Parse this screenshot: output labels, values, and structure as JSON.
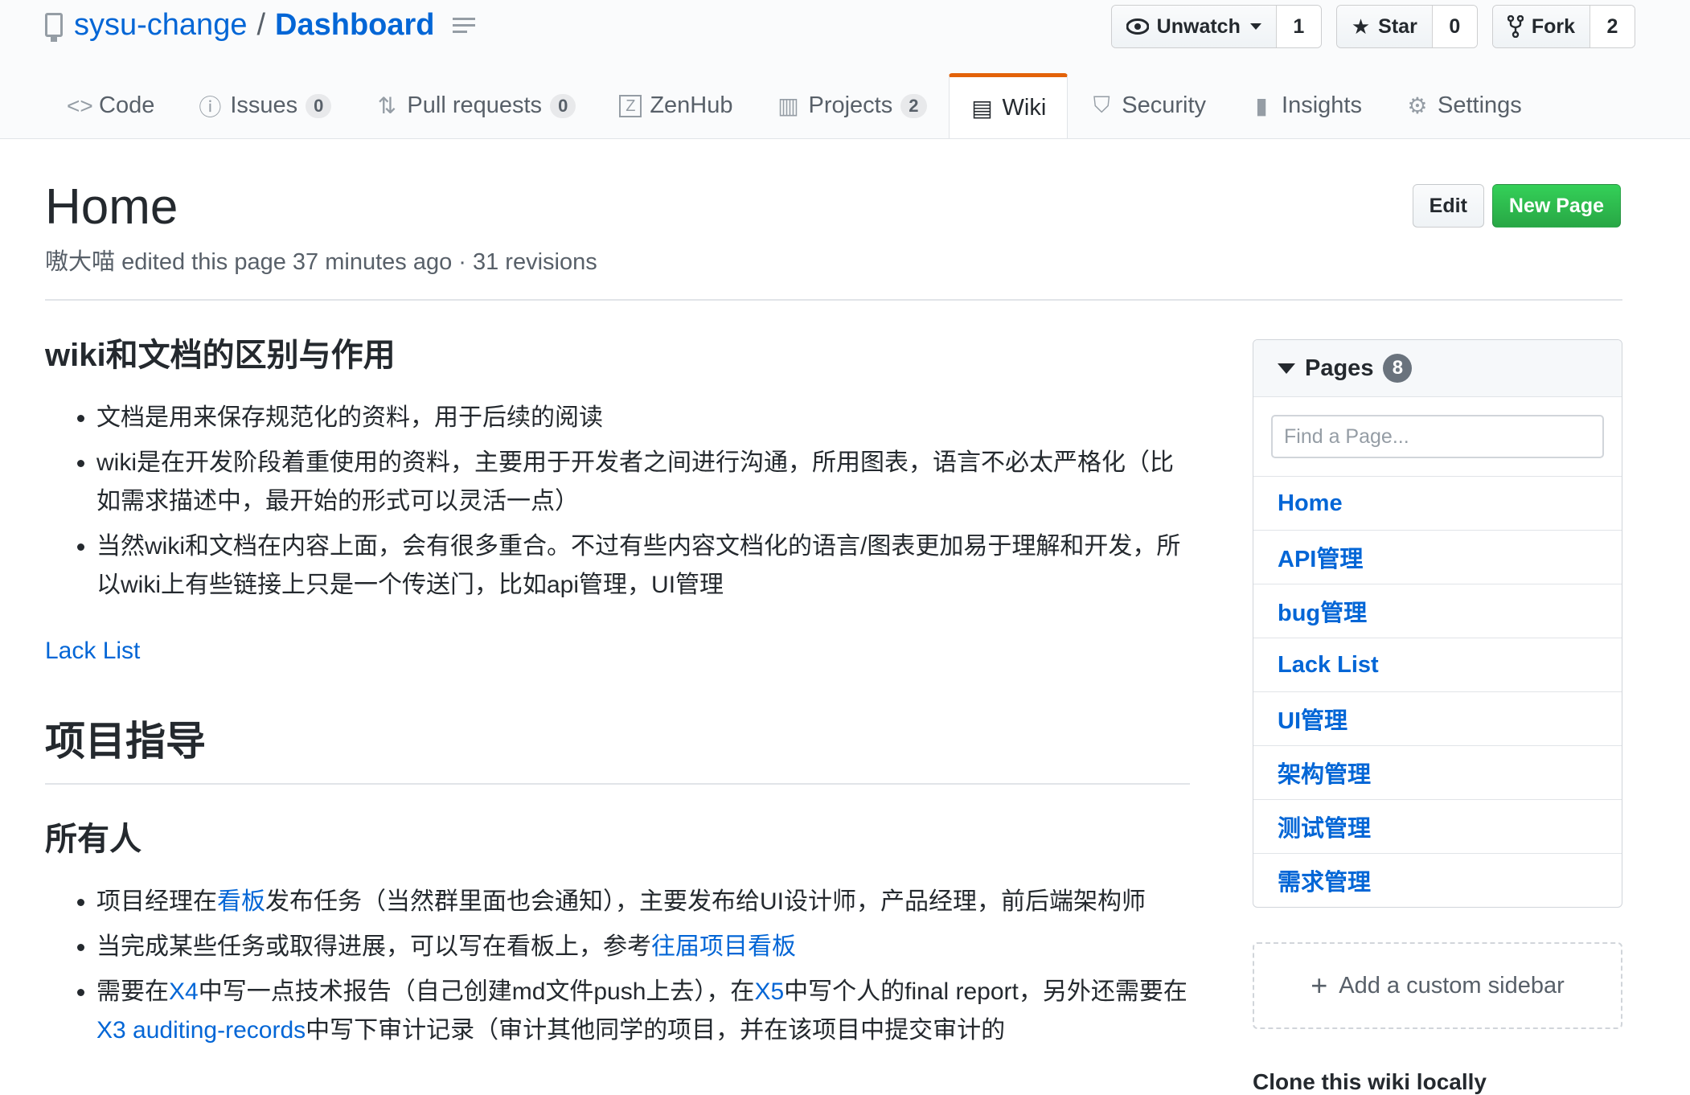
{
  "repo": {
    "owner": "sysu-change",
    "separator": "/",
    "name": "Dashboard"
  },
  "actions": {
    "watch": {
      "label": "Unwatch",
      "count": "1"
    },
    "star": {
      "label": "Star",
      "count": "0"
    },
    "fork": {
      "label": "Fork",
      "count": "2"
    }
  },
  "tabs": [
    {
      "label": "Code",
      "icon": "code-icon"
    },
    {
      "label": "Issues",
      "icon": "issue-icon",
      "counter": "0"
    },
    {
      "label": "Pull requests",
      "icon": "pull-request-icon",
      "counter": "0"
    },
    {
      "label": "ZenHub",
      "icon": "zenhub-icon"
    },
    {
      "label": "Projects",
      "icon": "project-icon",
      "counter": "2"
    },
    {
      "label": "Wiki",
      "icon": "book-icon",
      "selected": true
    },
    {
      "label": "Security",
      "icon": "shield-icon"
    },
    {
      "label": "Insights",
      "icon": "graph-icon"
    },
    {
      "label": "Settings",
      "icon": "gear-icon"
    }
  ],
  "page": {
    "title": "Home",
    "author": "嗷大喵",
    "edited_text": "edited this page 37 minutes ago · 31 revisions",
    "edit_label": "Edit",
    "new_page_label": "New Page"
  },
  "content": {
    "section1": {
      "heading": "wiki和文档的区别与作用",
      "items": [
        "文档是用来保存规范化的资料，用于后续的阅读",
        "wiki是在开发阶段着重使用的资料，主要用于开发者之间进行沟通，所用图表，语言不必太严格化（比如需求描述中，最开始的形式可以灵活一点）",
        "当然wiki和文档在内容上面，会有很多重合。不过有些内容文档化的语言/图表更加易于理解和开发，所以wiki上有些链接上只是一个传送门，比如api管理，UI管理"
      ]
    },
    "lack_list_link": "Lack List",
    "section2": {
      "heading": "项目指导"
    },
    "section3": {
      "heading": "所有人",
      "item1": {
        "before": "项目经理在",
        "link": "看板",
        "after": "发布任务（当然群里面也会通知），主要发布给UI设计师，产品经理，前后端架构师"
      },
      "item2": {
        "before": "当完成某些任务或取得进展，可以写在看板上，参考",
        "link": "往届项目看板"
      },
      "item3": {
        "t1": "需要在",
        "link1": "X4",
        "t2": "中写一点技术报告（自己创建md文件push上去），在",
        "link2": "X5",
        "t3": "中写个人的final report，另外还需要在",
        "link3": "X3 auditing-records",
        "t4": "中写下审计记录（审计其他同学的项目，并在该项目中提交审计的"
      }
    }
  },
  "sidebar": {
    "title": "Pages",
    "count": "8",
    "search_placeholder": "Find a Page...",
    "pages": [
      "Home",
      "API管理",
      "bug管理",
      "Lack List",
      "UI管理",
      "架构管理",
      "测试管理",
      "需求管理"
    ],
    "add_custom_label": "Add a custom sidebar",
    "clone_label": "Clone this wiki locally"
  },
  "colors": {
    "link": "#0366d6",
    "accent_tab": "#e36209",
    "new_page_green": "#28a745"
  }
}
